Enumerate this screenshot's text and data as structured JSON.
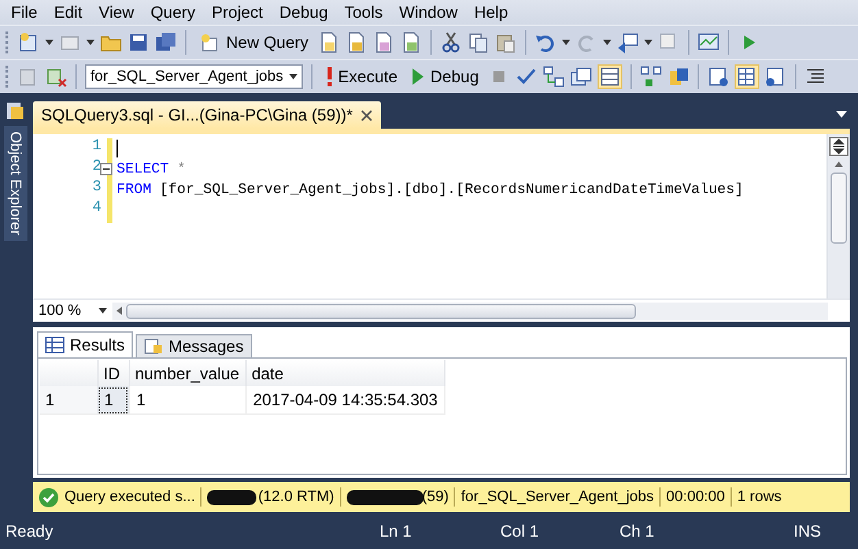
{
  "menu": [
    "File",
    "Edit",
    "View",
    "Query",
    "Project",
    "Debug",
    "Tools",
    "Window",
    "Help"
  ],
  "toolbar": {
    "new_query": "New Query",
    "database": "for_SQL_Server_Agent_jobs",
    "execute": "Execute",
    "debug": "Debug"
  },
  "sidebar": {
    "label": "Object Explorer"
  },
  "document_tab": {
    "title": "SQLQuery3.sql - GI...(Gina-PC\\Gina (59))*"
  },
  "editor": {
    "lines": [
      {
        "number": "1",
        "cursor": true
      },
      {
        "number": "2",
        "collapsible": true,
        "tokens": [
          {
            "kind": "keyword",
            "text": "SELECT"
          },
          {
            "kind": "operator",
            "text": "*"
          }
        ]
      },
      {
        "number": "3",
        "tokens": [
          {
            "kind": "keyword",
            "text": "FROM"
          },
          {
            "kind": "plain",
            "text": "[for_SQL_Server_Agent_jobs].[dbo].[RecordsNumericandDateTimeValues]"
          }
        ]
      },
      {
        "number": "4"
      }
    ]
  },
  "zoom": "100 %",
  "results_tabs": [
    {
      "label": "Results",
      "selected": true
    },
    {
      "label": "Messages",
      "selected": false
    }
  ],
  "grid": {
    "columns": [
      "ID",
      "number_value",
      "date"
    ],
    "rows": [
      {
        "row_number": "1",
        "cells": [
          {
            "text": "1",
            "selected": true
          },
          {
            "text": "1",
            "selected": false
          },
          {
            "text": "2017-04-09 14:35:54.303",
            "selected": false
          }
        ]
      }
    ]
  },
  "query_status": {
    "message": "Query executed s...",
    "server_version": "(12.0 RTM)",
    "session": "(59)",
    "database": "for_SQL_Server_Agent_jobs",
    "elapsed": "00:00:00",
    "rows": "1 rows"
  },
  "status_bar": {
    "ready": "Ready",
    "line": "Ln 1",
    "column": "Col 1",
    "char": "Ch 1",
    "mode": "INS"
  }
}
